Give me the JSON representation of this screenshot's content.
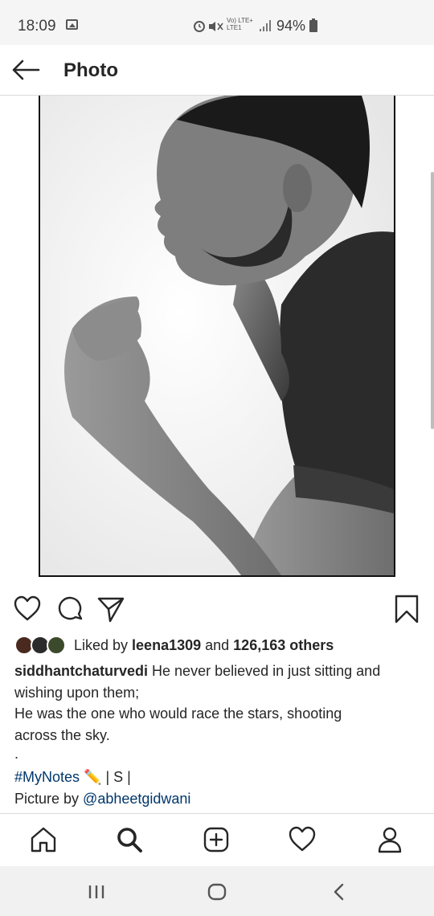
{
  "status_bar": {
    "time": "18:09",
    "network": "Vo) LTE+\nLTE1",
    "icons_left": "⏰ ♪",
    "battery": "94%"
  },
  "header": {
    "title": "Photo",
    "back_icon": "back-arrow-icon"
  },
  "post": {
    "image_icon": "photo",
    "actions": [
      "like-icon",
      "comment-icon",
      "share-icon",
      "save-icon"
    ],
    "likes": {
      "prefix": "Liked by ",
      "user": "leena1309",
      "middle": " and ",
      "count": "126,163 others"
    },
    "caption": {
      "username": "siddhantchaturvedi",
      "line1_rest": " He never believed in just sitting and",
      "line2": "wishing upon them;",
      "line3": "He was the one who would race the stars, shooting",
      "line4": "across the sky.",
      "line5": ".",
      "hashtag": "#MyNotes",
      "hashtag_suffix": " ✏️ | S |",
      "credit_prefix": "Picture by ",
      "credit_user": "@abheetgidwani"
    }
  },
  "bottom_nav": [
    "home-icon",
    "search-icon",
    "add-post-icon",
    "activity-icon",
    "profile-icon"
  ],
  "system_nav": [
    "recent-apps-icon",
    "home-button-icon",
    "back-button-icon"
  ],
  "colors": {
    "link": "#00376b",
    "text": "#262626",
    "divider": "#dbdbdb"
  }
}
